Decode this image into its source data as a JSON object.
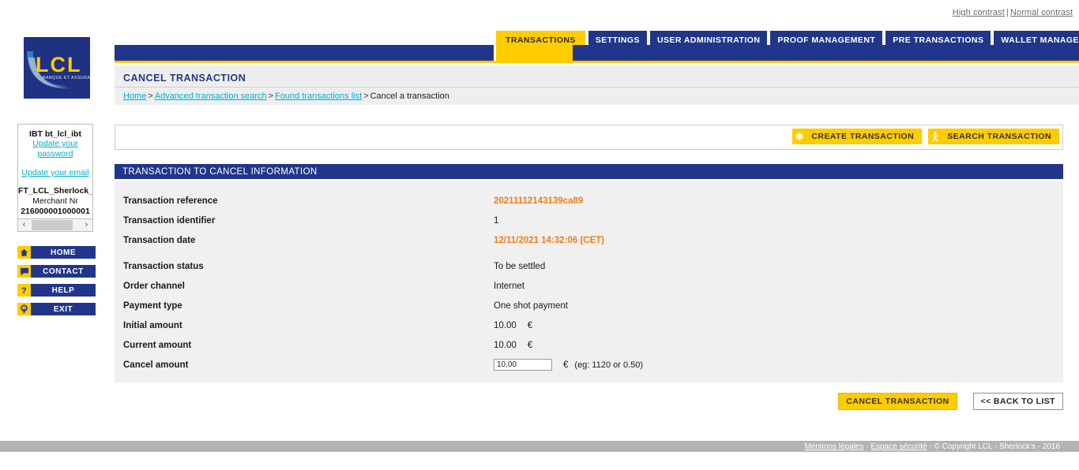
{
  "accessibility": {
    "high_contrast": "High contrast",
    "separator": "|",
    "normal_contrast": "Normal contrast"
  },
  "brand": {
    "name": "LCL",
    "tagline": "BANQUE ET ASSURANCE",
    "logo_bg": "#1f3182",
    "logo_fg": "#ffcc00"
  },
  "colors": {
    "navy": "#21368a",
    "yellow": "#ffcc00",
    "accent_orange": "#f07d18",
    "link_cyan": "#00b0c8",
    "panel_grey": "#f0f0f0",
    "footer_grey": "#b3b3b3"
  },
  "tabs": [
    {
      "label": "TRANSACTIONS",
      "active": true
    },
    {
      "label": "SETTINGS",
      "active": false
    },
    {
      "label": "USER ADMINISTRATION",
      "active": false
    },
    {
      "label": "PROOF MANAGEMENT",
      "active": false
    },
    {
      "label": "PRE TRANSACTIONS",
      "active": false
    },
    {
      "label": "WALLET MANAGEMENT",
      "active": false
    }
  ],
  "page": {
    "title": "CANCEL TRANSACTION"
  },
  "breadcrumb": {
    "items": [
      {
        "label": "Home",
        "link": true
      },
      {
        "label": "Advanced transaction search",
        "link": true
      },
      {
        "label": "Found transactions list",
        "link": true
      },
      {
        "label": "Cancel a transaction",
        "link": false
      }
    ],
    "separator": ">"
  },
  "sidebar": {
    "user": {
      "name": "IBT bt_lcl_ibt",
      "update_password": "Update your password",
      "update_email": "Update your email",
      "contract": "FT_LCL_Sherlock_S",
      "merchant_label": "Merchant Nr",
      "merchant_number": "216000001000001"
    },
    "scrollbar": {
      "left_arrow": "‹",
      "right_arrow": "›"
    },
    "menu": [
      {
        "label": "HOME",
        "icon": "home-icon"
      },
      {
        "label": "CONTACT",
        "icon": "speech-bubble-icon"
      },
      {
        "label": "HELP",
        "icon": "question-mark-icon"
      },
      {
        "label": "EXIT",
        "icon": "power-icon"
      }
    ]
  },
  "toolbar": {
    "create_transaction": "CREATE TRANSACTION",
    "search_transaction": "SEARCH TRANSACTION"
  },
  "section": {
    "heading": "TRANSACTION TO CANCEL INFORMATION"
  },
  "fields": [
    {
      "label": "Transaction reference",
      "value": "20211112143139ca89",
      "accent": true
    },
    {
      "label": "Transaction identifier",
      "value": "1",
      "accent": false
    },
    {
      "label": "Transaction date",
      "value": "12/11/2021 14:32:06 (CET)",
      "accent": true
    },
    {
      "label": "Transaction status",
      "value": "To be settled",
      "accent": false
    },
    {
      "label": "Order channel",
      "value": "Internet",
      "accent": false
    },
    {
      "label": "Payment type",
      "value": "One shot payment",
      "accent": false
    },
    {
      "label": "Initial amount",
      "value": "10.00",
      "currency": "€",
      "accent": false
    },
    {
      "label": "Current amount",
      "value": "10.00",
      "currency": "€",
      "accent": false
    }
  ],
  "cancel_amount": {
    "label": "Cancel amount",
    "value": "10,00",
    "placeholder": "",
    "currency": "€",
    "hint": "(eg: 1120 or 0.50)"
  },
  "actions": {
    "cancel_transaction": "CANCEL TRANSACTION",
    "back_to_list": "<< BACK TO LIST"
  },
  "footer": {
    "legal": "Mentions légales",
    "security": "Espace sécurité",
    "copyright": "© Copyright LCL - Sherlock's - 2016",
    "dash": "-"
  }
}
